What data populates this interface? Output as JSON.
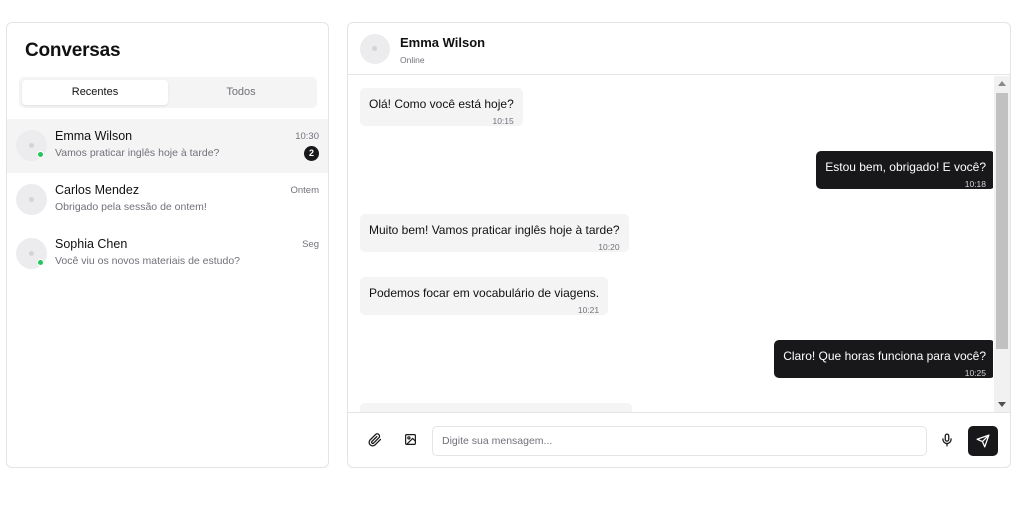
{
  "sidebar": {
    "title": "Conversas",
    "tabs": [
      {
        "label": "Recentes",
        "active": true
      },
      {
        "label": "Todos",
        "active": false
      }
    ],
    "conversations": [
      {
        "name": "Emma Wilson",
        "preview": "Vamos praticar inglês hoje à tarde?",
        "time": "10:30",
        "unread": "2",
        "online": true,
        "selected": true
      },
      {
        "name": "Carlos Mendez",
        "preview": "Obrigado pela sessão de ontem!",
        "time": "Ontem",
        "online": false,
        "selected": false
      },
      {
        "name": "Sophia Chen",
        "preview": "Você viu os novos materiais de estudo?",
        "time": "Seg",
        "online": true,
        "selected": false
      }
    ]
  },
  "chat": {
    "contact_name": "Emma Wilson",
    "contact_status": "Online",
    "messages": [
      {
        "direction": "in",
        "text": "Olá! Como você está hoje?",
        "time": "10:15"
      },
      {
        "direction": "out",
        "text": "Estou bem, obrigado! E você?",
        "time": "10:18"
      },
      {
        "direction": "in",
        "text": "Muito bem! Vamos praticar inglês hoje à tarde?",
        "time": "10:20"
      },
      {
        "direction": "in",
        "text": "Podemos focar em vocabulário de viagens.",
        "time": "10:21"
      },
      {
        "direction": "out",
        "text": "Claro! Que horas funciona para você?",
        "time": "10:25"
      }
    ]
  },
  "composer": {
    "placeholder": "Digite sua mensagem...",
    "icons": [
      "paperclip-icon",
      "image-icon",
      "microphone-icon",
      "send-icon"
    ]
  },
  "colors": {
    "online": "#22c55e",
    "outgoing_bubble": "#18181b",
    "incoming_bubble": "#f4f4f5",
    "selected_row": "#f4f4f5"
  }
}
